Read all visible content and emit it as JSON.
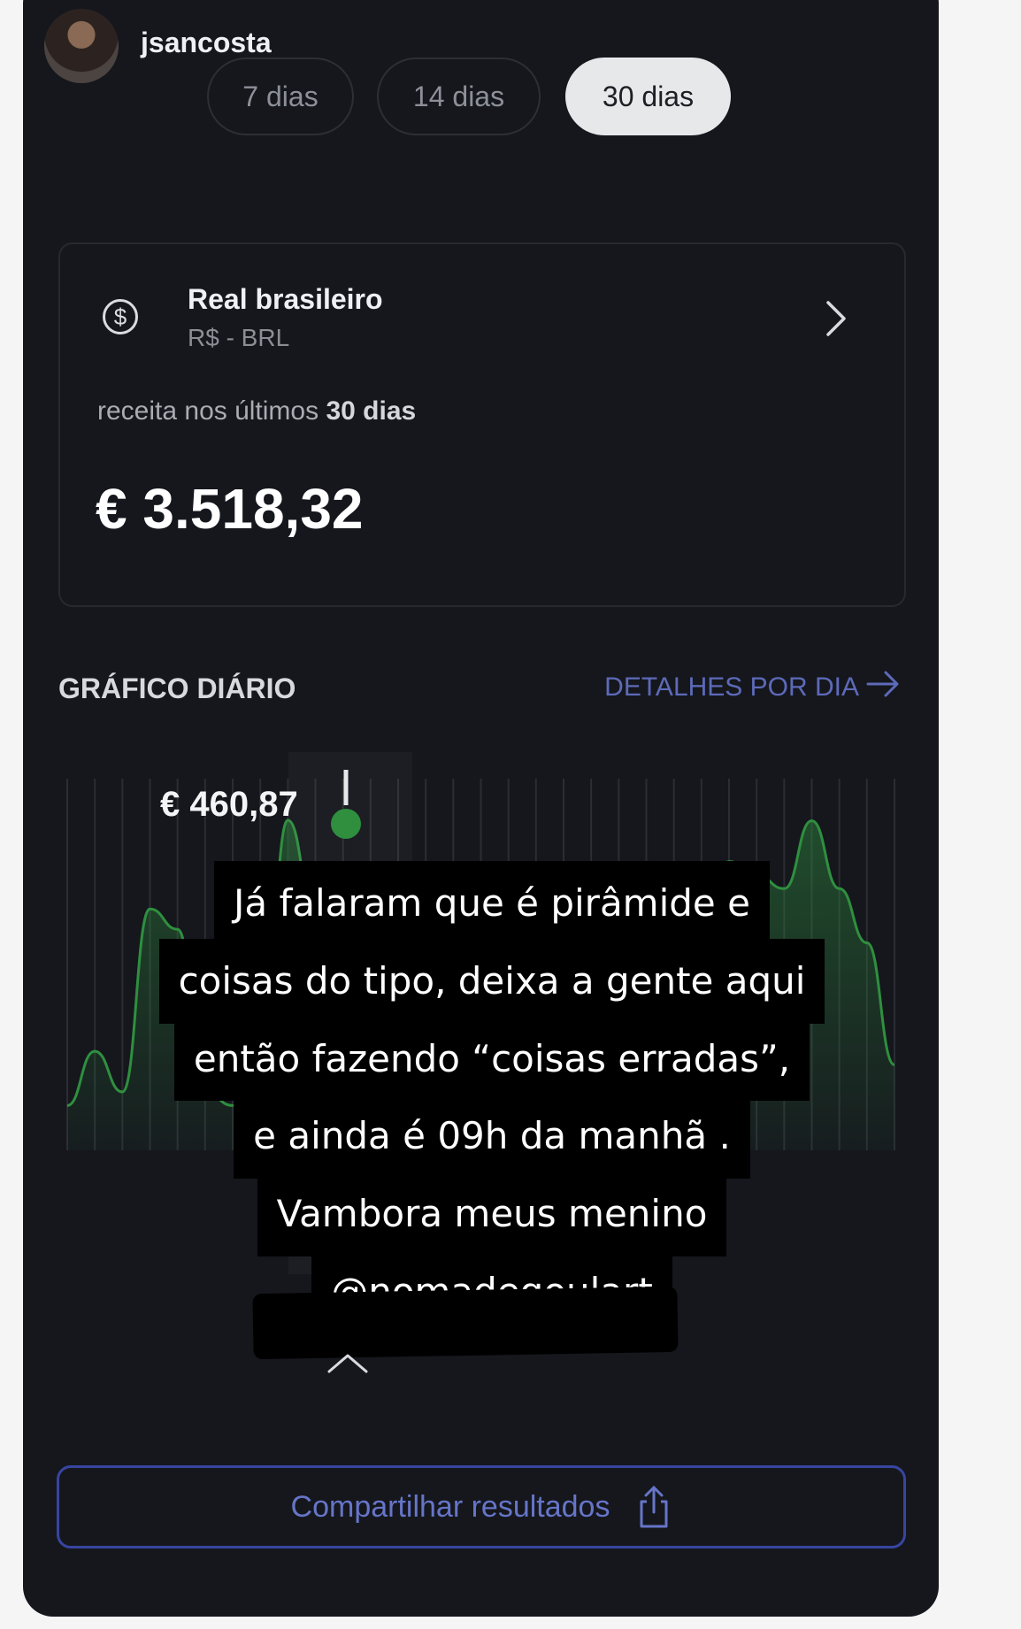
{
  "header": {
    "username": "jsancosta"
  },
  "periods": [
    {
      "label": "7 dias",
      "active": false
    },
    {
      "label": "14 dias",
      "active": false
    },
    {
      "label": "30 dias",
      "active": true
    }
  ],
  "currency_card": {
    "name": "Real brasileiro",
    "code": "R$ - BRL",
    "revenue_prefix": "receita nos últimos",
    "revenue_period": "30 dias",
    "amount": "€ 3.518,32"
  },
  "daily_chart": {
    "title": "GRÁFICO DIÁRIO",
    "details_link": "DETALHES POR DIA",
    "tooltip_value": "€ 460,87"
  },
  "chart_data": {
    "type": "area",
    "title": "GRÁFICO DIÁRIO",
    "series": [
      {
        "values": [
          40,
          120,
          60,
          330,
          300,
          60,
          40,
          55,
          460.87,
          320,
          300,
          360,
          250,
          230,
          260,
          220,
          200,
          230,
          180,
          160,
          200,
          330,
          380,
          300,
          400,
          380,
          360,
          460,
          360,
          280,
          100
        ]
      }
    ],
    "highlighted_value": 460.87,
    "grid": true
  },
  "story_caption": {
    "lines": [
      "Já falaram que é pirâmide e",
      "coisas do tipo, deixa a gente aqui",
      "então fazendo “coisas erradas”,",
      "e ainda é 09h da manhã .",
      "Vambora meus menino",
      "@nomadegoulart"
    ]
  },
  "share": {
    "label": "Compartilhar resultados"
  },
  "colors": {
    "accent": "#3845a0",
    "chart_line": "#2f8f3f",
    "background": "#15171d"
  },
  "icons": [
    "dollar-circle-icon",
    "chevron-right-icon",
    "arrow-right-icon",
    "chevron-up-icon",
    "share-icon"
  ]
}
